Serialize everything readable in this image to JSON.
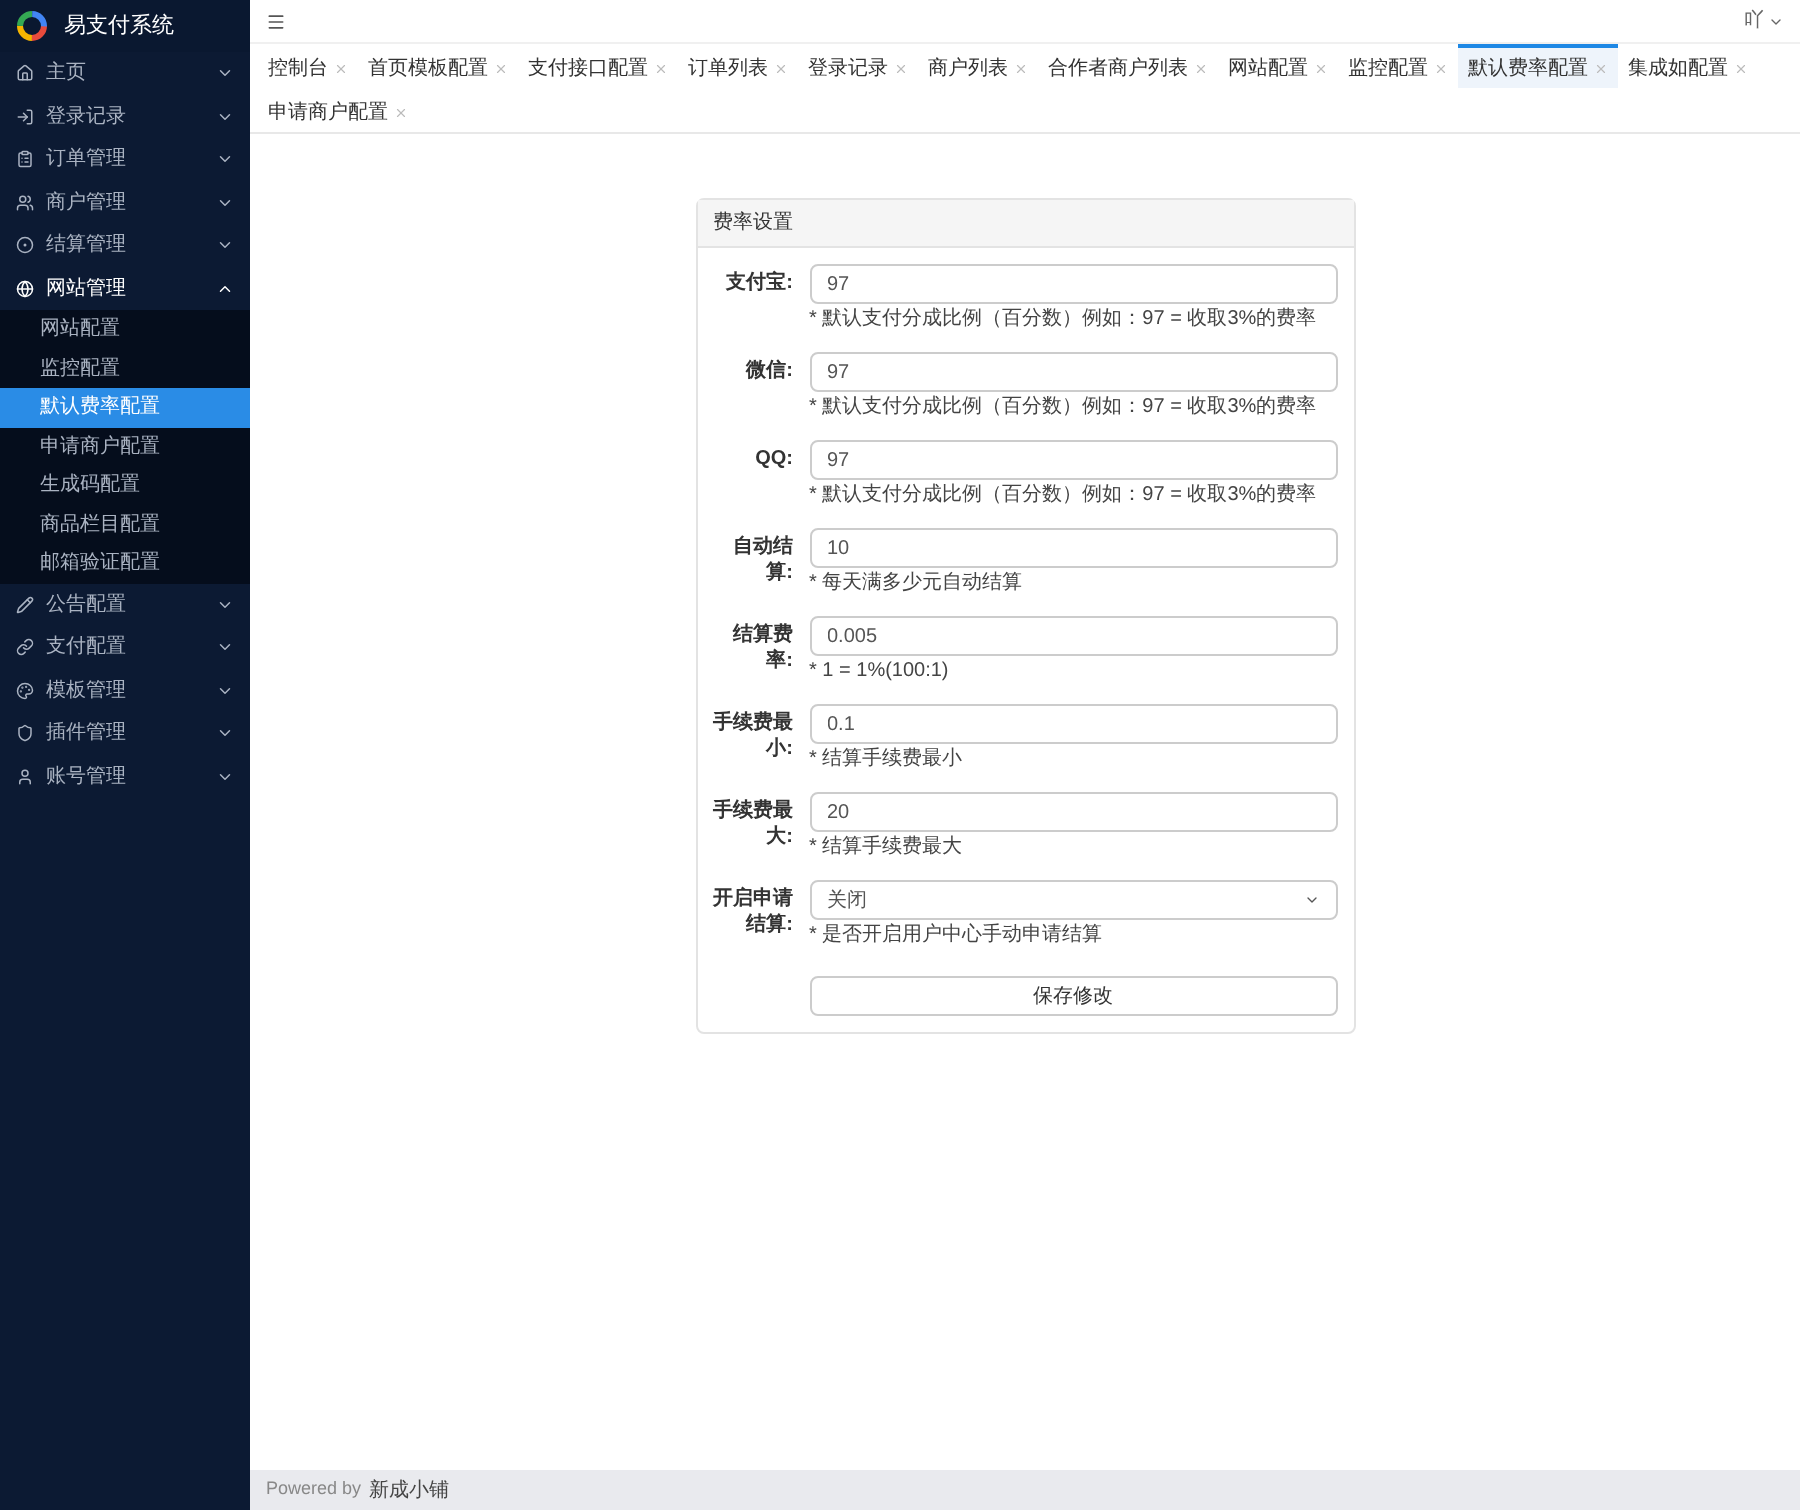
{
  "sidebar": {
    "logo_text": "易支付系统",
    "items": [
      {
        "label": "主页",
        "expanded": false
      },
      {
        "label": "登录记录",
        "expanded": false
      },
      {
        "label": "订单管理",
        "expanded": false
      },
      {
        "label": "商户管理",
        "expanded": false
      },
      {
        "label": "结算管理",
        "expanded": false
      },
      {
        "label": "网站管理",
        "expanded": true,
        "children": [
          {
            "label": "网站配置",
            "selected": false
          },
          {
            "label": "监控配置",
            "selected": false
          },
          {
            "label": "默认费率配置",
            "selected": true
          },
          {
            "label": "申请商户配置",
            "selected": false
          },
          {
            "label": "生成码配置",
            "selected": false
          },
          {
            "label": "商品栏目配置",
            "selected": false
          },
          {
            "label": "邮箱验证配置",
            "selected": false
          }
        ]
      },
      {
        "label": "公告配置",
        "expanded": false
      },
      {
        "label": "支付配置",
        "expanded": false
      },
      {
        "label": "模板管理",
        "expanded": false
      },
      {
        "label": "插件管理",
        "expanded": false
      },
      {
        "label": "账号管理",
        "expanded": false
      }
    ]
  },
  "header": {
    "user": "吖"
  },
  "tabs": [
    {
      "label": "控制台",
      "selected": false
    },
    {
      "label": "首页模板配置",
      "selected": false
    },
    {
      "label": "支付接口配置",
      "selected": false
    },
    {
      "label": "订单列表",
      "selected": false
    },
    {
      "label": "登录记录",
      "selected": false
    },
    {
      "label": "商户列表",
      "selected": false
    },
    {
      "label": "合作者商户列表",
      "selected": false
    },
    {
      "label": "网站配置",
      "selected": false
    },
    {
      "label": "监控配置",
      "selected": false
    },
    {
      "label": "默认费率配置",
      "selected": true
    },
    {
      "label": "集成如配置",
      "selected": false
    },
    {
      "label": "申请商户配置",
      "selected": false
    }
  ],
  "form": {
    "title": "费率设置",
    "fields": [
      {
        "kind": "input",
        "label": "支付宝:",
        "value": "97",
        "hint": "* 默认支付分成比例（百分数）例如：97 = 收取3%的费率"
      },
      {
        "kind": "input",
        "label": "微信:",
        "value": "97",
        "hint": "* 默认支付分成比例（百分数）例如：97 = 收取3%的费率"
      },
      {
        "kind": "input",
        "label": "QQ:",
        "value": "97",
        "hint": "* 默认支付分成比例（百分数）例如：97 = 收取3%的费率"
      },
      {
        "kind": "input",
        "label": "自动结算:",
        "value": "10",
        "hint": "* 每天满多少元自动结算"
      },
      {
        "kind": "input",
        "label": "结算费率:",
        "value": "0.005",
        "hint": "* 1 = 1%(100:1)"
      },
      {
        "kind": "input",
        "label": "手续费最小:",
        "value": "0.1",
        "hint": "* 结算手续费最小"
      },
      {
        "kind": "input",
        "label": "手续费最大:",
        "value": "20",
        "hint": "* 结算手续费最大"
      },
      {
        "kind": "select",
        "label": "开启申请结算:",
        "value": "关闭",
        "hint": "* 是否开启用户中心手动申请结算"
      }
    ],
    "submit": "保存修改"
  },
  "footer": {
    "prefix": "Powered by",
    "brand": "新成小铺"
  }
}
